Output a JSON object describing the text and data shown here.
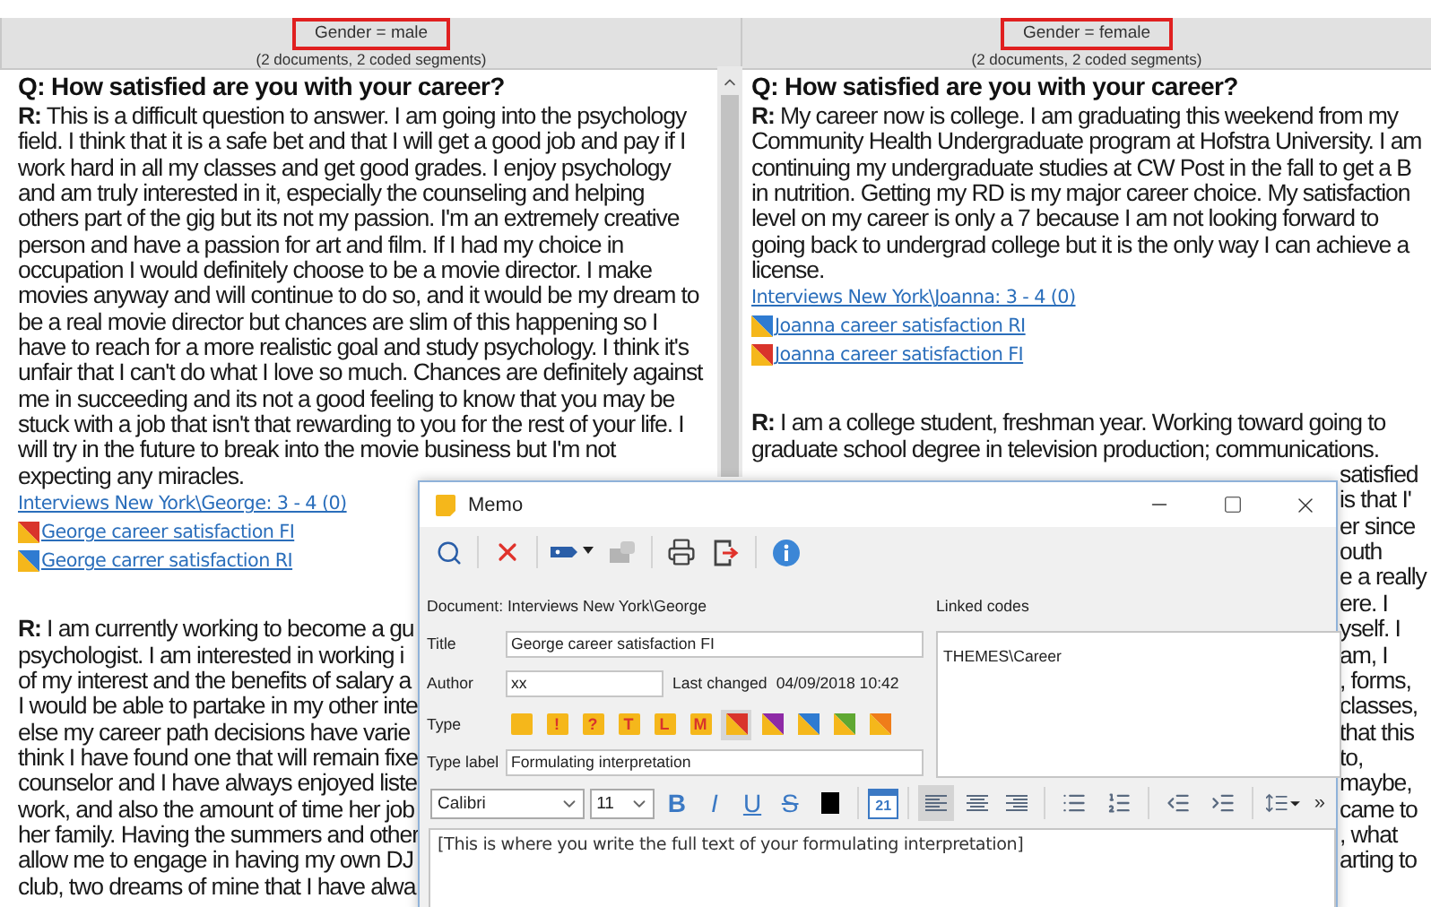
{
  "columns": [
    {
      "header": {
        "label": "Gender = male",
        "highlighted": true,
        "summary": "(2 documents, 2 coded segments)"
      },
      "question": "Q: How satisfied are you with your career?",
      "responses": [
        {
          "lines": [
            "**R:** This is a difficult question to answer. I am going into the psychology",
            "field. I think that it is a safe bet and that I will get a good job and pay if I",
            "work hard in all my classes and get good grades. I enjoy psychology",
            "and am truly interested in it, especially the counseling and helping",
            "others part of the gig but its not my passion. I'm an extremely creative",
            "person and have a passion for art and film. If I had my choice in",
            "occupation I would definitely choose to be a movie director. I make",
            "movies anyway and will continue to do so, and it would be my dream to",
            "be a real movie director but chances are slim of this happening so I",
            "have to reach for a more realistic goal and study psychology. I think it's",
            "unfair that I can't do what I love so much. Chances are definitely against",
            "me in succeeding and its not a good feeling to know that you may be",
            "stuck with a job that isn't that rewarding to you for the rest of your life. I",
            "will try in the future to break into the movie business but I'm not",
            "expecting any miracles."
          ],
          "source": "Interviews New York\\George: 3 - 4  (0)",
          "memos": [
            {
              "title": "George career satisfaction FI",
              "color": "#d9342b"
            },
            {
              "title": "George carrer satisfaction RI",
              "color": "#2f7bd1"
            }
          ]
        },
        {
          "lines": [
            "**R:** I am currently working to become a gu",
            "psychologist. I am interested in working i",
            "of my interest and the benefits of salary a",
            "I would be able to partake in my other inte",
            "else my career path decisions have varie",
            "think I have found one that will remain fixe",
            "counselor and I have always enjoyed liste",
            "work, and also the amount of time her job",
            "her family. Having the summers and other",
            "allow me to engage in having my own DJ",
            "club, two dreams of mine that I have alwa"
          ]
        }
      ]
    },
    {
      "header": {
        "label": "Gender = female",
        "highlighted": true,
        "summary": "(2 documents, 2 coded segments)"
      },
      "question": "Q: How satisfied are you with your career?",
      "responses": [
        {
          "lines": [
            "**R:** My career now is college. I am graduating this weekend from my",
            "Community Health Undergraduate program at Hofstra University. I am",
            "continuing my undergraduate studies at CW Post in the fall to get a B",
            "in nutrition. Getting my RD is my major career choice. My satisfaction",
            "level on my career is only a 7 because I am not looking forward to",
            "going back to undergrad college but it is the only way I can achieve a",
            "license."
          ],
          "source": "Interviews New York\\Joanna: 3 - 4  (0)",
          "memos": [
            {
              "title": "Joanna career satisfaction RI",
              "color": "#2f7bd1"
            },
            {
              "title": "Joanna career satisfaction FI",
              "color": "#d9342b"
            }
          ]
        },
        {
          "lines": [
            "**R:** I am a college student, freshman year. Working toward going to",
            "graduate school degree in television production; communications."
          ],
          "fragments": [
            "satisfied",
            "is that I'",
            "er since",
            "outh",
            "e a really",
            "ere. I",
            "yself. I",
            "am, I",
            ", forms,",
            "classes,",
            "that this",
            "to,",
            "maybe,",
            "came to",
            ", what",
            "arting to"
          ]
        }
      ]
    }
  ],
  "memo_window": {
    "title": "Memo",
    "document": "Document: Interviews New York\\George",
    "linked_codes_label": "Linked codes",
    "linked_codes": [
      "THEMES\\Career"
    ],
    "title_field": {
      "label": "Title",
      "value": "George career satisfaction FI"
    },
    "author_field": {
      "label": "Author",
      "value": "xx"
    },
    "last_changed": {
      "label": "Last changed",
      "value": "04/09/2018 10:42"
    },
    "type": {
      "label": "Type",
      "options": [
        {
          "kind": "plain",
          "selected": false
        },
        {
          "kind": "letter",
          "symbol": "!",
          "selected": false
        },
        {
          "kind": "letter",
          "symbol": "?",
          "selected": false
        },
        {
          "kind": "letter",
          "symbol": "T",
          "selected": false
        },
        {
          "kind": "letter",
          "symbol": "L",
          "selected": false
        },
        {
          "kind": "letter",
          "symbol": "M",
          "selected": false
        },
        {
          "kind": "diagonal",
          "color": "#d9342b",
          "selected": true
        },
        {
          "kind": "diagonal",
          "color": "#8e2aa6",
          "selected": false
        },
        {
          "kind": "diagonal",
          "color": "#2f7bd1",
          "selected": false
        },
        {
          "kind": "diagonal",
          "color": "#5fa832",
          "selected": false
        },
        {
          "kind": "diagonal",
          "color": "#ef7d1a",
          "selected": false
        }
      ]
    },
    "type_label_field": {
      "label": "Type label",
      "value": "Formulating interpretation"
    },
    "format": {
      "font": "Calibri",
      "size": "11",
      "styles": [
        "B",
        "I",
        "U",
        "S"
      ],
      "calendar_day": "21",
      "alignments": [
        {
          "kind": "left",
          "selected": true
        },
        {
          "kind": "center",
          "selected": false
        },
        {
          "kind": "right",
          "selected": false
        }
      ],
      "more": "»"
    },
    "body": "[This is where you write the full text of your formulating interpretation]"
  }
}
